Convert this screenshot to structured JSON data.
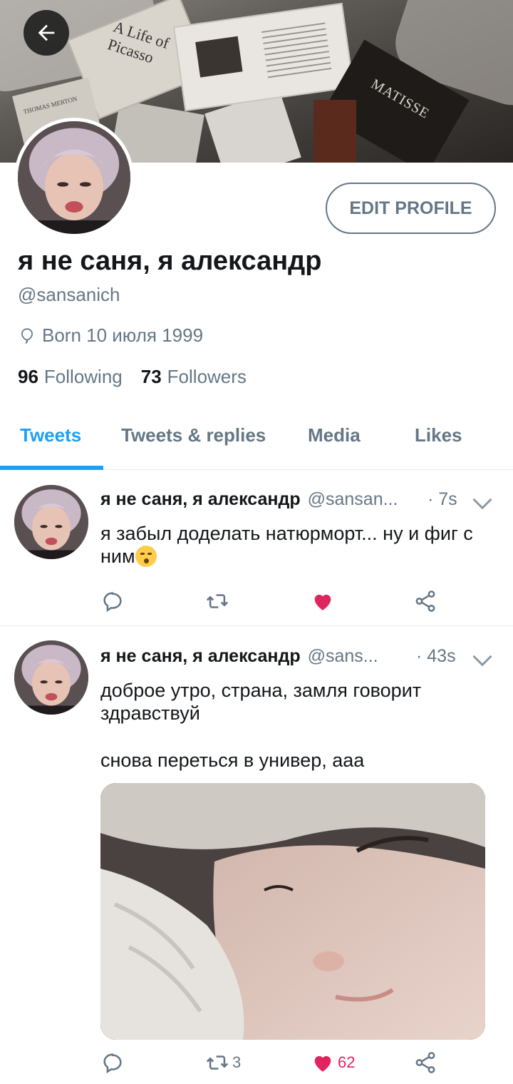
{
  "header": {
    "back_icon": "arrow-left-icon",
    "banner_book_titles": [
      "A Life of Picasso",
      "MATISSE",
      "THOMAS MERTON"
    ]
  },
  "profile": {
    "edit_label": "EDIT PROFILE",
    "display_name": "я не саня, я александр",
    "handle": "@sansanich",
    "born": "Born 10 июля 1999",
    "following_count": "96",
    "following_label": "Following",
    "followers_count": "73",
    "followers_label": "Followers"
  },
  "tabs": [
    {
      "label": "Tweets",
      "active": true
    },
    {
      "label": "Tweets & replies",
      "active": false
    },
    {
      "label": "Media",
      "active": false
    },
    {
      "label": "Likes",
      "active": false
    }
  ],
  "tweets": [
    {
      "name": "я не саня, я александр",
      "handle": "@sansan...",
      "time": "· 7s",
      "text_line1": "я забыл доделать натюрморт... ну и фиг с",
      "text_line2": "ним",
      "emoji": "kissing-face-emoji",
      "retweet_count": "",
      "like_count": "",
      "liked": true
    },
    {
      "name": "я не саня, я александр",
      "handle": "@sans...",
      "time": "· 43s",
      "text": "доброе утро, страна, замля говорит здравствуй",
      "text2": "снова переться в универ, ааа",
      "retweet_count": "3",
      "like_count": "62",
      "liked": true
    }
  ],
  "colors": {
    "accent": "#1da1f2",
    "secondary_text": "#657786",
    "like": "#e0245e"
  }
}
